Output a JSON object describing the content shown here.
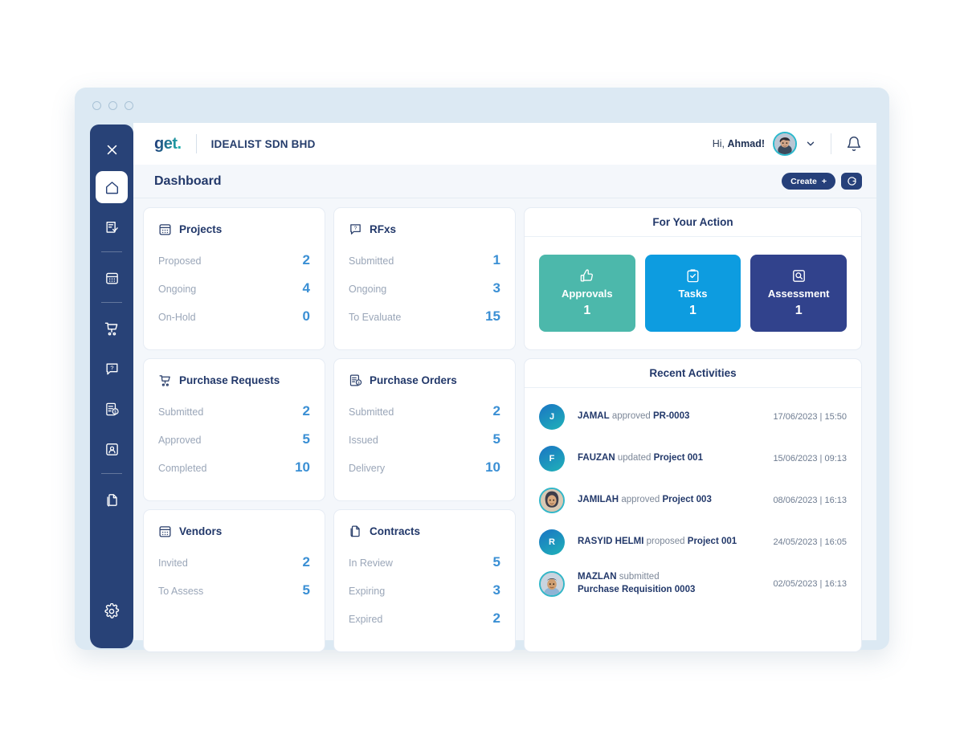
{
  "window": {
    "dots": [
      "close-dot",
      "minimize-dot",
      "maximize-dot"
    ]
  },
  "sidebar": {
    "close_label": "×",
    "items": [
      {
        "name": "home",
        "icon": "home-icon",
        "active": true
      },
      {
        "name": "approvals",
        "icon": "checklist-icon",
        "active": false
      },
      {
        "name": "projects",
        "icon": "calendar-grid-icon",
        "active": false
      },
      {
        "name": "purchase-requests",
        "icon": "cart-icon",
        "active": false
      },
      {
        "name": "rfxs",
        "icon": "question-bubble-icon",
        "active": false
      },
      {
        "name": "purchase-orders",
        "icon": "invoice-dollar-icon",
        "active": false
      },
      {
        "name": "vendors",
        "icon": "vendor-card-icon",
        "active": false
      },
      {
        "name": "contracts",
        "icon": "documents-icon",
        "active": false
      }
    ],
    "settings_icon": "gear-icon"
  },
  "header": {
    "logo": "get.",
    "org": "IDEALIST SDN BHD",
    "greeting_prefix": "Hi, ",
    "greeting_name": "Ahmad!",
    "avatar_icon": "user-avatar",
    "chevron_icon": "chevron-down-icon",
    "bell_icon": "bell-icon"
  },
  "pagebar": {
    "title": "Dashboard",
    "create_label": "Create",
    "create_plus": "+",
    "refresh_icon": "refresh-icon"
  },
  "cards": [
    {
      "title": "Projects",
      "icon": "calendar-grid-icon",
      "stats": [
        {
          "label": "Proposed",
          "value": "2"
        },
        {
          "label": "Ongoing",
          "value": "4"
        },
        {
          "label": "On-Hold",
          "value": "0"
        }
      ]
    },
    {
      "title": "RFxs",
      "icon": "question-bubble-icon",
      "stats": [
        {
          "label": "Submitted",
          "value": "1"
        },
        {
          "label": "Ongoing",
          "value": "3"
        },
        {
          "label": "To Evaluate",
          "value": "15"
        }
      ]
    },
    {
      "title": "Purchase Requests",
      "icon": "cart-icon",
      "stats": [
        {
          "label": "Submitted",
          "value": "2"
        },
        {
          "label": "Approved",
          "value": "5"
        },
        {
          "label": "Completed",
          "value": "10"
        }
      ]
    },
    {
      "title": "Purchase Orders",
      "icon": "invoice-dollar-icon",
      "stats": [
        {
          "label": "Submitted",
          "value": "2"
        },
        {
          "label": "Issued",
          "value": "5"
        },
        {
          "label": "Delivery",
          "value": "10"
        }
      ]
    },
    {
      "title": "Vendors",
      "icon": "calendar-grid-icon",
      "stats": [
        {
          "label": "Invited",
          "value": "2"
        },
        {
          "label": "To Assess",
          "value": "5"
        }
      ]
    },
    {
      "title": "Contracts",
      "icon": "documents-icon",
      "stats": [
        {
          "label": "In Review",
          "value": "5"
        },
        {
          "label": "Expiring",
          "value": "3"
        },
        {
          "label": "Expired",
          "value": "2"
        }
      ]
    }
  ],
  "for_your_action": {
    "title": "For Your Action",
    "tiles": [
      {
        "label": "Approvals",
        "count": "1",
        "icon": "thumbs-up-icon",
        "color": "#4cb8ab"
      },
      {
        "label": "Tasks",
        "count": "1",
        "icon": "clipboard-check-icon",
        "color": "#0d9ce0"
      },
      {
        "label": "Assessment",
        "count": "1",
        "icon": "magnifier-box-icon",
        "color": "#31428c"
      }
    ]
  },
  "recent_activities": {
    "title": "Recent Activities",
    "items": [
      {
        "initial": "J",
        "photo": false,
        "actor": "JAMAL",
        "action": " approved ",
        "target": "PR-0003",
        "time": "17/06/2023 | 15:50"
      },
      {
        "initial": "F",
        "photo": false,
        "actor": "FAUZAN",
        "action": " updated ",
        "target": "Project 001",
        "time": "15/06/2023 | 09:13"
      },
      {
        "initial": "",
        "photo": true,
        "actor": "JAMILAH",
        "action": " approved ",
        "target": "Project 003",
        "time": "08/06/2023 | 16:13"
      },
      {
        "initial": "R",
        "photo": false,
        "actor": "RASYID HELMI",
        "action": " proposed ",
        "target": "Project 001",
        "time": "24/05/2023 | 16:05"
      },
      {
        "initial": "",
        "photo": true,
        "actor": "MAZLAN",
        "action": " submitted ",
        "target": "Purchase Requisition 0003",
        "time": "02/05/2023 | 16:13",
        "two_line": true
      }
    ]
  },
  "colors": {
    "sidebar": "#284277",
    "accent_blue": "#3a8fd4",
    "navy": "#22386a",
    "window_chrome": "#dce9f3",
    "page_bg": "#f4f7fb"
  }
}
